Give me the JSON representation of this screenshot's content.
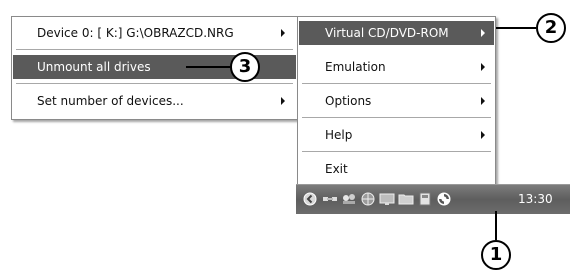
{
  "left_menu": {
    "items": [
      {
        "label": "Device 0: [ K:] G:\\OBRAZCD.NRG",
        "has_submenu": true,
        "selected": false
      },
      {
        "label": "Unmount all drives",
        "has_submenu": false,
        "selected": true
      },
      {
        "label": "Set number of devices...",
        "has_submenu": true,
        "selected": false
      }
    ]
  },
  "main_menu": {
    "items": [
      {
        "label": "Virtual CD/DVD-ROM",
        "has_submenu": true,
        "selected": true
      },
      {
        "label": "Emulation",
        "has_submenu": true,
        "selected": false
      },
      {
        "label": "Options",
        "has_submenu": true,
        "selected": false
      },
      {
        "label": "Help",
        "has_submenu": true,
        "selected": false
      },
      {
        "label": "Exit",
        "has_submenu": false,
        "selected": false
      }
    ]
  },
  "taskbar": {
    "clock": "13:30",
    "tray_icons": [
      "show-hidden-icon",
      "network-icon",
      "tray-app-icon",
      "globe-icon",
      "monitor-icon",
      "folder-icon",
      "drive-icon",
      "daemon-tools-icon"
    ]
  },
  "callouts": {
    "one": "1",
    "two": "2",
    "three": "3"
  },
  "colors": {
    "selection": "#5a5a5a",
    "taskbar": "#6c6c6c"
  }
}
